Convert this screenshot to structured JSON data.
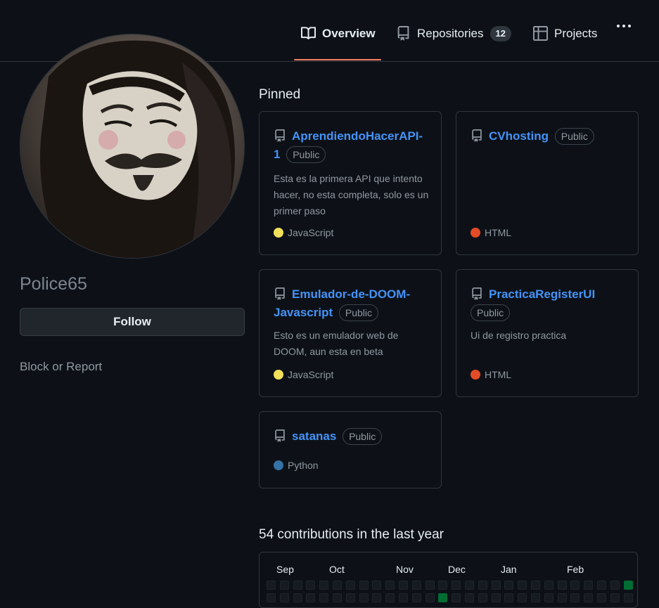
{
  "nav": {
    "tabs": [
      {
        "label": "Overview",
        "icon": "book-icon",
        "active": true
      },
      {
        "label": "Repositories",
        "icon": "repo-icon",
        "count": "12"
      },
      {
        "label": "Projects",
        "icon": "table-icon"
      }
    ],
    "more_icon": "kebab-horizontal-icon",
    "accent_color": "#f78166"
  },
  "profile": {
    "username": "Police65",
    "follow_label": "Follow",
    "block_label": "Block or Report"
  },
  "pinned": {
    "title": "Pinned",
    "repos": [
      {
        "name": "AprendiendoHacerAPI-1",
        "visibility": "Public",
        "description": "Esta es la primera API que intento hacer, no esta completa, solo es un primer paso",
        "language": "JavaScript",
        "language_color": "#f1e05a"
      },
      {
        "name": "CVhosting",
        "visibility": "Public",
        "description": "",
        "language": "HTML",
        "language_color": "#e34c26"
      },
      {
        "name": "Emulador-de-DOOM-Javascript",
        "visibility": "Public",
        "description": "Esto es un emulador web de DOOM, aun esta en beta",
        "language": "JavaScript",
        "language_color": "#f1e05a"
      },
      {
        "name": "PracticaRegisterUI",
        "visibility": "Public",
        "description": "Ui de registro practica",
        "language": "HTML",
        "language_color": "#e34c26"
      },
      {
        "name": "satanas",
        "visibility": "Public",
        "description": "",
        "language": "Python",
        "language_color": "#3572A5"
      }
    ]
  },
  "contributions": {
    "title": "54 contributions in the last year",
    "months": [
      "Sep",
      "Oct",
      "Nov",
      "Dec",
      "Jan",
      "Feb"
    ],
    "level_colors": [
      "#161b22",
      "#0e4429",
      "#006d32",
      "#26a641",
      "#39d353"
    ]
  }
}
